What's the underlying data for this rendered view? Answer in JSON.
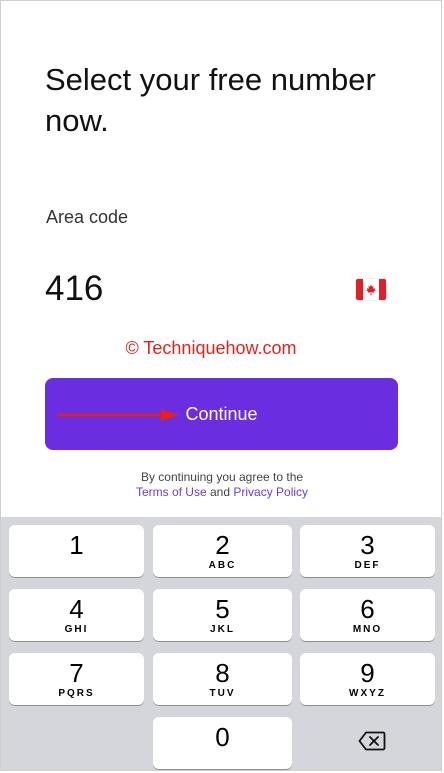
{
  "screen": {
    "title": "Select your free number now.",
    "area_code_label": "Area code",
    "area_code_value": "416",
    "flag_icon": "canada-flag-icon",
    "watermark": "© Techniquehow.com",
    "continue_label": "Continue",
    "legal_prefix": "By continuing you agree to the",
    "terms_link": "Terms of Use",
    "legal_and": "and",
    "privacy_link": "Privacy Policy"
  },
  "colors": {
    "accent": "#6a2de0",
    "link": "#6a3be3",
    "watermark": "#e8201c",
    "keypad_bg": "#d4d6db"
  },
  "keypad": {
    "keys": [
      {
        "digit": "1",
        "letters": ""
      },
      {
        "digit": "2",
        "letters": "ABC"
      },
      {
        "digit": "3",
        "letters": "DEF"
      },
      {
        "digit": "4",
        "letters": "GHI"
      },
      {
        "digit": "5",
        "letters": "JKL"
      },
      {
        "digit": "6",
        "letters": "MNO"
      },
      {
        "digit": "7",
        "letters": "PQRS"
      },
      {
        "digit": "8",
        "letters": "TUV"
      },
      {
        "digit": "9",
        "letters": "WXYZ"
      },
      {
        "digit": "0",
        "letters": ""
      }
    ],
    "delete_icon": "backspace-icon"
  }
}
